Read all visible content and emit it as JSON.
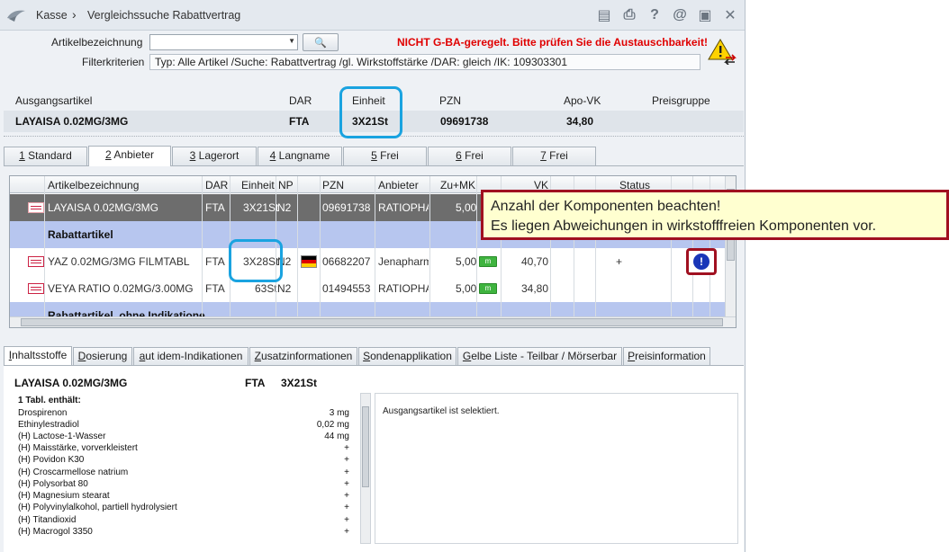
{
  "titlebar": {
    "crumb_home": "Kasse",
    "separator": "›",
    "crumb_current": "Vergleichssuche Rabattvertrag",
    "icons": [
      "clipboard-icon",
      "print-icon",
      "help-icon",
      "email-icon",
      "screen-icon",
      "close-icon"
    ],
    "icon_glyphs": [
      "▤",
      "⎙",
      "?",
      "@",
      "▣",
      "✕"
    ]
  },
  "filter": {
    "artikel_label": "Artikelbezeichnung",
    "artikel_value": "",
    "search_glyph": "🔍",
    "warning": "NICHT G-BA-geregelt. Bitte prüfen Sie die Austauschbarkeit!",
    "filter_label": "Filterkriterien",
    "filter_value": "Typ: Alle Artikel /Suche: Rabattvertrag /gl. Wirkstoffstärke /DAR: gleich /IK: 109303301"
  },
  "ausgang": {
    "headers": {
      "artikel": "Ausgangsartikel",
      "dar": "DAR",
      "einheit": "Einheit",
      "pzn": "PZN",
      "apo_vk": "Apo-VK",
      "preisgruppe": "Preisgruppe"
    },
    "values": {
      "artikel": "LAYAISA 0.02MG/3MG",
      "dar": "FTA",
      "einheit": "3X21St",
      "pzn": "09691738",
      "apo_vk": "34,80",
      "preisgruppe": ""
    }
  },
  "tabs_top": [
    {
      "key": "1",
      "label": "Standard"
    },
    {
      "key": "2",
      "label": "Anbieter"
    },
    {
      "key": "3",
      "label": "Lagerort"
    },
    {
      "key": "4",
      "label": "Langname"
    },
    {
      "key": "5",
      "label": "Frei"
    },
    {
      "key": "6",
      "label": "Frei"
    },
    {
      "key": "7",
      "label": "Frei"
    }
  ],
  "grid": {
    "headers": {
      "artikel": "Artikelbezeichnung",
      "dar": "DAR",
      "einheit": "Einheit",
      "np": "NP",
      "pzn": "PZN",
      "anbieter": "Anbieter",
      "zumk": "Zu+MK",
      "vk": "VK",
      "status": "Status"
    },
    "rows": [
      {
        "type": "selected",
        "artikel": "LAYAISA 0.02MG/3MG",
        "dar": "FTA",
        "einheit": "3X21St",
        "np": "N2",
        "pzn": "09691738",
        "anbieter": "RATIOPHA",
        "zumk": "5,00"
      },
      {
        "type": "group",
        "label": "Rabattartikel"
      },
      {
        "type": "normal",
        "artikel": "YAZ 0.02MG/3MG FILMTABL",
        "dar": "FTA",
        "einheit": "3X28St",
        "np": "N2",
        "pzn": "06682207",
        "anbieter": "Jenapharm",
        "zumk": "5,00",
        "badge": "m",
        "vk": "40,70",
        "status": "+"
      },
      {
        "type": "normal",
        "artikel": "VEYA RATIO 0.02MG/3.00MG",
        "dar": "FTA",
        "einheit": "63St",
        "np": "N2",
        "pzn": "01494553",
        "anbieter": "RATIOPHA",
        "zumk": "5,00",
        "badge": "m",
        "vk": "34,80",
        "status": ""
      },
      {
        "type": "group",
        "label": "Rabattartikel, ohne Indikatione"
      }
    ],
    "flag": [
      "#000000",
      "#dd0000",
      "#ffce00"
    ]
  },
  "tooltip": {
    "line1": "Anzahl der Komponenten beachten!",
    "line2": "Es liegen Abweichungen in wirkstofffreien Komponenten vor."
  },
  "tabs_bottom": [
    {
      "label": "Inhaltsstoffe",
      "hot": "I",
      "rest": "nhaltsstoffe"
    },
    {
      "label": "Dosierung",
      "hot": "D",
      "rest": "osierung"
    },
    {
      "label": "aut idem-Indikationen",
      "hot": "a",
      "rest": "ut idem-Indikationen"
    },
    {
      "label": "Zusatzinformationen",
      "hot": "Z",
      "rest": "usatzinformationen"
    },
    {
      "label": "Sondenapplikation",
      "hot": "S",
      "rest": "ondenapplikation"
    },
    {
      "label": "Gelbe Liste - Teilbar / Mörserbar",
      "hot": "G",
      "rest": "elbe Liste - Teilbar / Mörserbar"
    },
    {
      "label": "Preisinformation",
      "hot": "P",
      "rest": "reisinformation"
    }
  ],
  "detail": {
    "artikel": "LAYAISA 0.02MG/3MG",
    "dar": "FTA",
    "einheit": "3X21St",
    "heading": "1 Tabl. enthält:",
    "ingredients": [
      {
        "name": "Drospirenon",
        "value": "3 mg"
      },
      {
        "name": "Ethinylestradiol",
        "value": "0,02 mg"
      },
      {
        "name": "(H) Lactose-1-Wasser",
        "value": "44 mg"
      },
      {
        "name": "(H) Maisstärke, vorverkleistert",
        "value": "+"
      },
      {
        "name": "(H) Povidon K30",
        "value": "+"
      },
      {
        "name": "(H) Croscarmellose natrium",
        "value": "+"
      },
      {
        "name": "(H) Polysorbat 80",
        "value": "+"
      },
      {
        "name": "(H) Magnesium stearat",
        "value": "+"
      },
      {
        "name": "(H) Polyvinylalkohol, partiell hydrolysiert",
        "value": "+"
      },
      {
        "name": "(H) Titandioxid",
        "value": "+"
      },
      {
        "name": "(H) Macrogol 3350",
        "value": "+"
      }
    ],
    "info": "Ausgangsartikel ist selektiert."
  }
}
